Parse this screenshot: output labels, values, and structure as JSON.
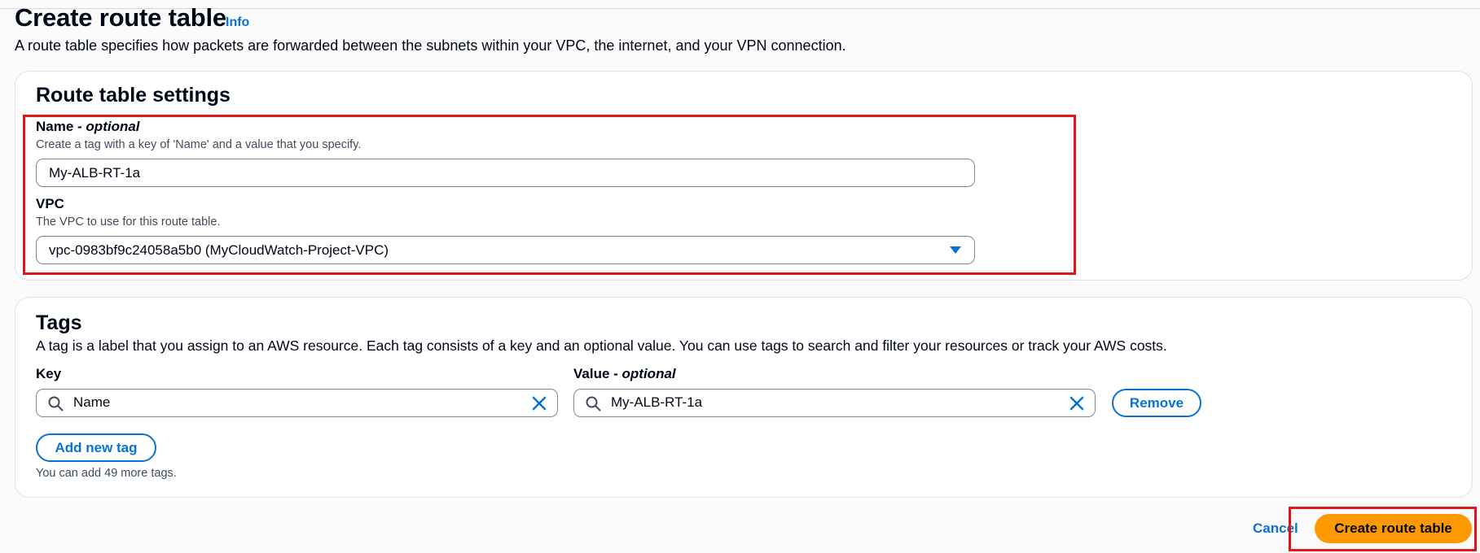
{
  "header": {
    "title": "Create route table",
    "info_link": "Info",
    "description": "A route table specifies how packets are forwarded between the subnets within your VPC, the internet, and your VPN connection."
  },
  "settings": {
    "title": "Route table settings",
    "name_label": "Name",
    "name_optional": "optional",
    "name_description": "Create a tag with a key of 'Name' and a value that you specify.",
    "name_value": "My-ALB-RT-1a",
    "vpc_label": "VPC",
    "vpc_description": "The VPC to use for this route table.",
    "vpc_value": "vpc-0983bf9c24058a5b0 (MyCloudWatch-Project-VPC)"
  },
  "tags": {
    "title": "Tags",
    "description": "A tag is a label that you assign to an AWS resource. Each tag consists of a key and an optional value. You can use tags to search and filter your resources or track your AWS costs.",
    "key_label": "Key",
    "value_label": "Value",
    "value_optional": "optional",
    "rows": [
      {
        "key": "Name",
        "value": "My-ALB-RT-1a"
      }
    ],
    "remove_label": "Remove",
    "add_label": "Add new tag",
    "hint": "You can add 49 more tags."
  },
  "footer": {
    "cancel_label": "Cancel",
    "submit_label": "Create route table"
  },
  "colors": {
    "accent": "#0972d3",
    "primary_button": "#ff9900",
    "highlight": "#e0161d"
  }
}
